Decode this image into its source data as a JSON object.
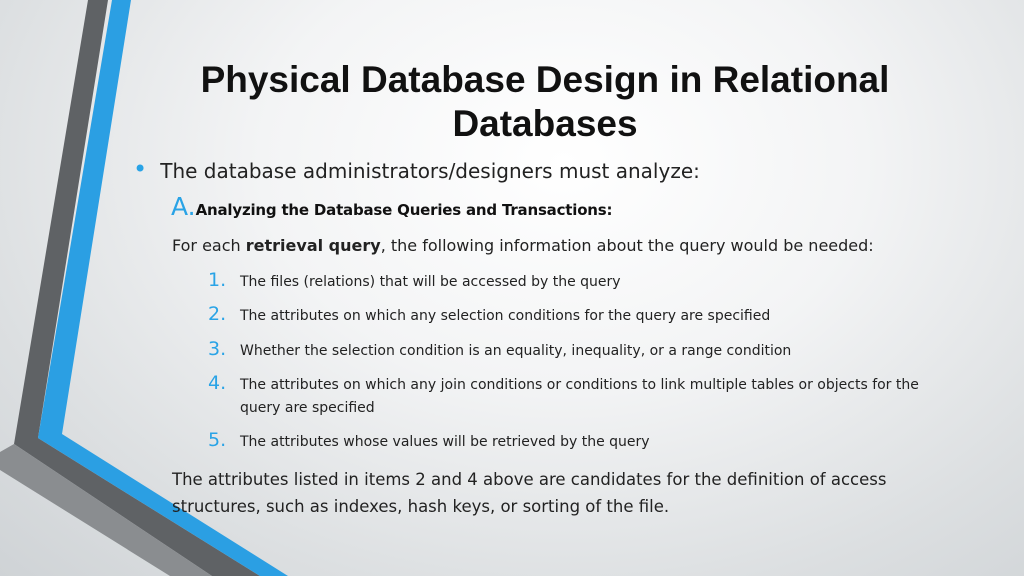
{
  "slide": {
    "title": "Physical Database Design in Relational Databases",
    "bullet": "The database administrators/designers must analyze:",
    "section": {
      "letter": "A.",
      "title": "Analyzing the Database Queries and Transactions:"
    },
    "intro": {
      "prefix": "For each ",
      "bold": "retrieval query",
      "suffix": ", the following information about the query would be needed:"
    },
    "items": [
      {
        "num": "1.",
        "text": "The files (relations) that will be accessed by the query"
      },
      {
        "num": "2.",
        "text": "The attributes on which any selection conditions for the query are specified"
      },
      {
        "num": "3.",
        "text": "Whether the selection condition is an equality, inequality, or a range condition"
      },
      {
        "num": "4.",
        "text": "The attributes on which any join conditions or conditions to link multiple tables or objects for the query are specified"
      },
      {
        "num": "5.",
        "text": "The attributes whose values will be retrieved by the query"
      }
    ],
    "closing": "The attributes listed in items 2 and 4 above are candidates for the definition of access structures, such as indexes, hash keys, or sorting of the file."
  },
  "theme": {
    "accent": "#29a3e6",
    "stripe_dark": "#5f6265",
    "stripe_blue": "#2b9fe3",
    "text": "#222222"
  }
}
